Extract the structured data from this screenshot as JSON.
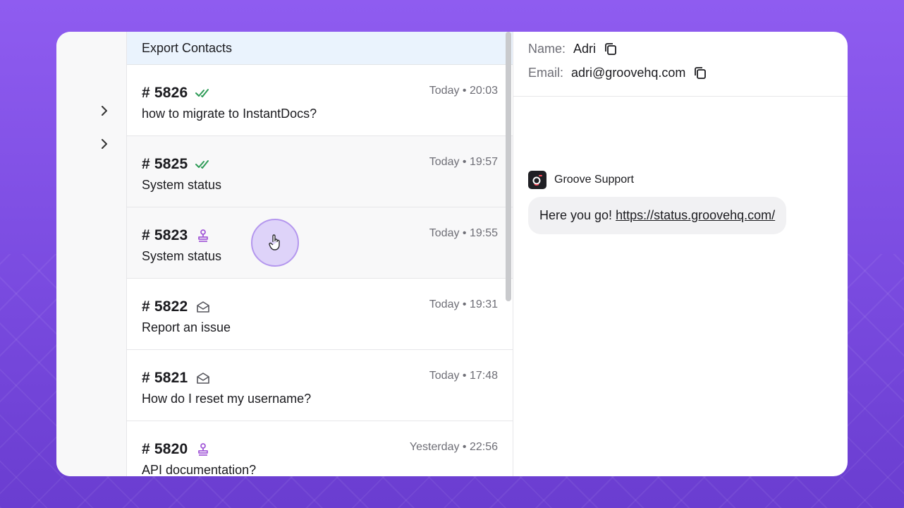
{
  "list": {
    "export_label": "Export Contacts",
    "tickets": [
      {
        "number": "# 5826",
        "time": "Today • 20:03",
        "subject": "how to migrate to InstantDocs?",
        "status_icon": "double-check-icon"
      },
      {
        "number": "# 5825",
        "time": "Today • 19:57",
        "subject": "System status",
        "status_icon": "double-check-icon"
      },
      {
        "number": "# 5823",
        "time": "Today • 19:55",
        "subject": "System status",
        "status_icon": "assigned-stamp-icon"
      },
      {
        "number": "# 5822",
        "time": "Today • 19:31",
        "subject": "Report an issue",
        "status_icon": "opened-envelope-icon"
      },
      {
        "number": "# 5821",
        "time": "Today • 17:48",
        "subject": "How do I reset my username?",
        "status_icon": "opened-envelope-icon"
      },
      {
        "number": "# 5820",
        "time": "Yesterday • 22:56",
        "subject": "API documentation?",
        "status_icon": "assigned-stamp-icon"
      }
    ]
  },
  "contact": {
    "name_label": "Name:",
    "name_value": "Adri",
    "email_label": "Email:",
    "email_value": "adri@groovehq.com"
  },
  "conversation": {
    "sender_name": "Groove Support",
    "message_text": "Here you go!",
    "message_link": "https://status.groovehq.com/"
  },
  "colors": {
    "accent_purple": "#8f5cf0",
    "check_green": "#2e9b57",
    "stamp_purple": "#a35ad8",
    "selected_row": "#eaf3fd"
  }
}
